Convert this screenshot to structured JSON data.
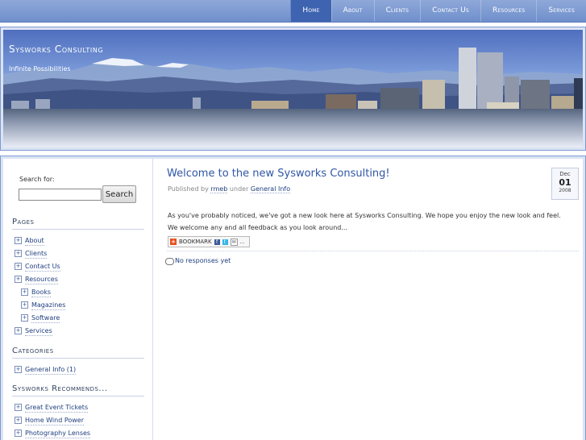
{
  "nav": {
    "items": [
      "Home",
      "About",
      "Clients",
      "Contact Us",
      "Resources",
      "Services"
    ],
    "active": "Home"
  },
  "header": {
    "title": "Sysworks Consulting",
    "tagline": "Infinite Possibilities"
  },
  "sidebar": {
    "search_label": "Search for:",
    "search_value": "",
    "search_button": "Search",
    "pages_heading": "Pages",
    "pages": [
      "About",
      "Clients",
      "Contact Us",
      "Resources",
      "Books",
      "Magazines",
      "Software",
      "Services"
    ],
    "categories_heading": "Categories",
    "categories": [
      "General Info (1)"
    ],
    "recommends_heading": "Sysworks Recommends...",
    "recommends": [
      "Great Event Tickets",
      "Home Wind Power",
      "Photography Lenses"
    ]
  },
  "post": {
    "title": "Welcome to the new Sysworks Consulting!",
    "meta_prefix": "Published by",
    "author": "rmeb",
    "meta_under": "under",
    "category": "General Info",
    "date": {
      "month": "Dec",
      "day": "01",
      "year": "2008"
    },
    "body": "As you've probably noticed, we've got a new look here at Sysworks Consulting. We hope you enjoy the new look and feel. We welcome any and all feedback as you look around...",
    "bookmark_label": "BOOKMARK",
    "responses": "No responses yet"
  },
  "colors": {
    "nav_bg": "#6f8fcb",
    "nav_active": "#3e63b0",
    "link": "#1f3f7f",
    "post_title": "#2f56a6",
    "frame_border": "#7f9bd2"
  }
}
